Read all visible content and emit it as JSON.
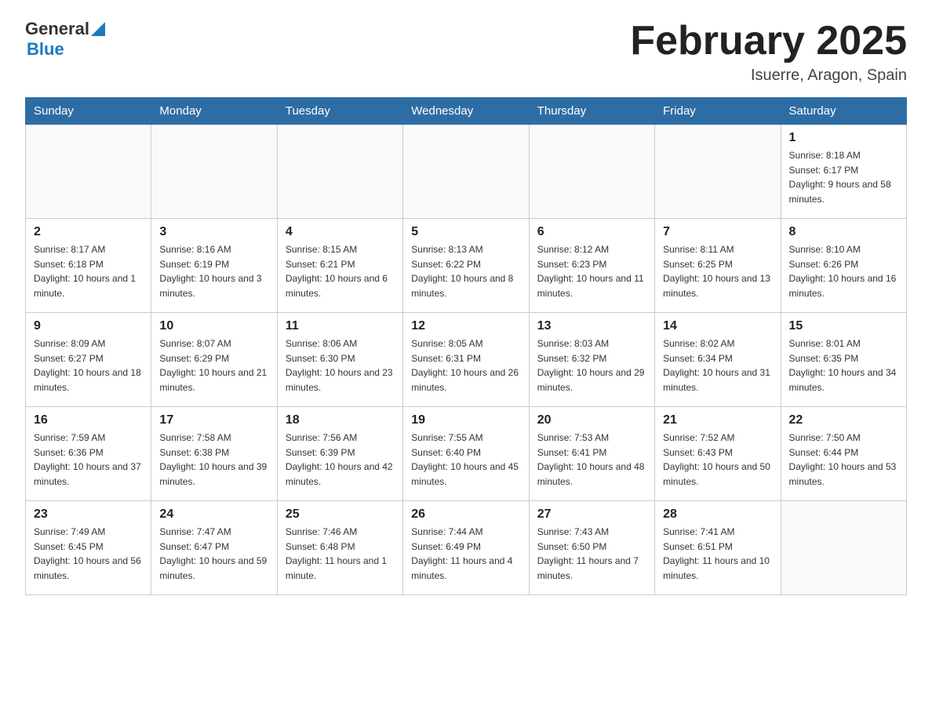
{
  "header": {
    "logo_general": "General",
    "logo_blue": "Blue",
    "month_title": "February 2025",
    "location": "Isuerre, Aragon, Spain"
  },
  "days_of_week": [
    "Sunday",
    "Monday",
    "Tuesday",
    "Wednesday",
    "Thursday",
    "Friday",
    "Saturday"
  ],
  "weeks": [
    [
      {
        "day": "",
        "info": ""
      },
      {
        "day": "",
        "info": ""
      },
      {
        "day": "",
        "info": ""
      },
      {
        "day": "",
        "info": ""
      },
      {
        "day": "",
        "info": ""
      },
      {
        "day": "",
        "info": ""
      },
      {
        "day": "1",
        "info": "Sunrise: 8:18 AM\nSunset: 6:17 PM\nDaylight: 9 hours and 58 minutes."
      }
    ],
    [
      {
        "day": "2",
        "info": "Sunrise: 8:17 AM\nSunset: 6:18 PM\nDaylight: 10 hours and 1 minute."
      },
      {
        "day": "3",
        "info": "Sunrise: 8:16 AM\nSunset: 6:19 PM\nDaylight: 10 hours and 3 minutes."
      },
      {
        "day": "4",
        "info": "Sunrise: 8:15 AM\nSunset: 6:21 PM\nDaylight: 10 hours and 6 minutes."
      },
      {
        "day": "5",
        "info": "Sunrise: 8:13 AM\nSunset: 6:22 PM\nDaylight: 10 hours and 8 minutes."
      },
      {
        "day": "6",
        "info": "Sunrise: 8:12 AM\nSunset: 6:23 PM\nDaylight: 10 hours and 11 minutes."
      },
      {
        "day": "7",
        "info": "Sunrise: 8:11 AM\nSunset: 6:25 PM\nDaylight: 10 hours and 13 minutes."
      },
      {
        "day": "8",
        "info": "Sunrise: 8:10 AM\nSunset: 6:26 PM\nDaylight: 10 hours and 16 minutes."
      }
    ],
    [
      {
        "day": "9",
        "info": "Sunrise: 8:09 AM\nSunset: 6:27 PM\nDaylight: 10 hours and 18 minutes."
      },
      {
        "day": "10",
        "info": "Sunrise: 8:07 AM\nSunset: 6:29 PM\nDaylight: 10 hours and 21 minutes."
      },
      {
        "day": "11",
        "info": "Sunrise: 8:06 AM\nSunset: 6:30 PM\nDaylight: 10 hours and 23 minutes."
      },
      {
        "day": "12",
        "info": "Sunrise: 8:05 AM\nSunset: 6:31 PM\nDaylight: 10 hours and 26 minutes."
      },
      {
        "day": "13",
        "info": "Sunrise: 8:03 AM\nSunset: 6:32 PM\nDaylight: 10 hours and 29 minutes."
      },
      {
        "day": "14",
        "info": "Sunrise: 8:02 AM\nSunset: 6:34 PM\nDaylight: 10 hours and 31 minutes."
      },
      {
        "day": "15",
        "info": "Sunrise: 8:01 AM\nSunset: 6:35 PM\nDaylight: 10 hours and 34 minutes."
      }
    ],
    [
      {
        "day": "16",
        "info": "Sunrise: 7:59 AM\nSunset: 6:36 PM\nDaylight: 10 hours and 37 minutes."
      },
      {
        "day": "17",
        "info": "Sunrise: 7:58 AM\nSunset: 6:38 PM\nDaylight: 10 hours and 39 minutes."
      },
      {
        "day": "18",
        "info": "Sunrise: 7:56 AM\nSunset: 6:39 PM\nDaylight: 10 hours and 42 minutes."
      },
      {
        "day": "19",
        "info": "Sunrise: 7:55 AM\nSunset: 6:40 PM\nDaylight: 10 hours and 45 minutes."
      },
      {
        "day": "20",
        "info": "Sunrise: 7:53 AM\nSunset: 6:41 PM\nDaylight: 10 hours and 48 minutes."
      },
      {
        "day": "21",
        "info": "Sunrise: 7:52 AM\nSunset: 6:43 PM\nDaylight: 10 hours and 50 minutes."
      },
      {
        "day": "22",
        "info": "Sunrise: 7:50 AM\nSunset: 6:44 PM\nDaylight: 10 hours and 53 minutes."
      }
    ],
    [
      {
        "day": "23",
        "info": "Sunrise: 7:49 AM\nSunset: 6:45 PM\nDaylight: 10 hours and 56 minutes."
      },
      {
        "day": "24",
        "info": "Sunrise: 7:47 AM\nSunset: 6:47 PM\nDaylight: 10 hours and 59 minutes."
      },
      {
        "day": "25",
        "info": "Sunrise: 7:46 AM\nSunset: 6:48 PM\nDaylight: 11 hours and 1 minute."
      },
      {
        "day": "26",
        "info": "Sunrise: 7:44 AM\nSunset: 6:49 PM\nDaylight: 11 hours and 4 minutes."
      },
      {
        "day": "27",
        "info": "Sunrise: 7:43 AM\nSunset: 6:50 PM\nDaylight: 11 hours and 7 minutes."
      },
      {
        "day": "28",
        "info": "Sunrise: 7:41 AM\nSunset: 6:51 PM\nDaylight: 11 hours and 10 minutes."
      },
      {
        "day": "",
        "info": ""
      }
    ]
  ]
}
